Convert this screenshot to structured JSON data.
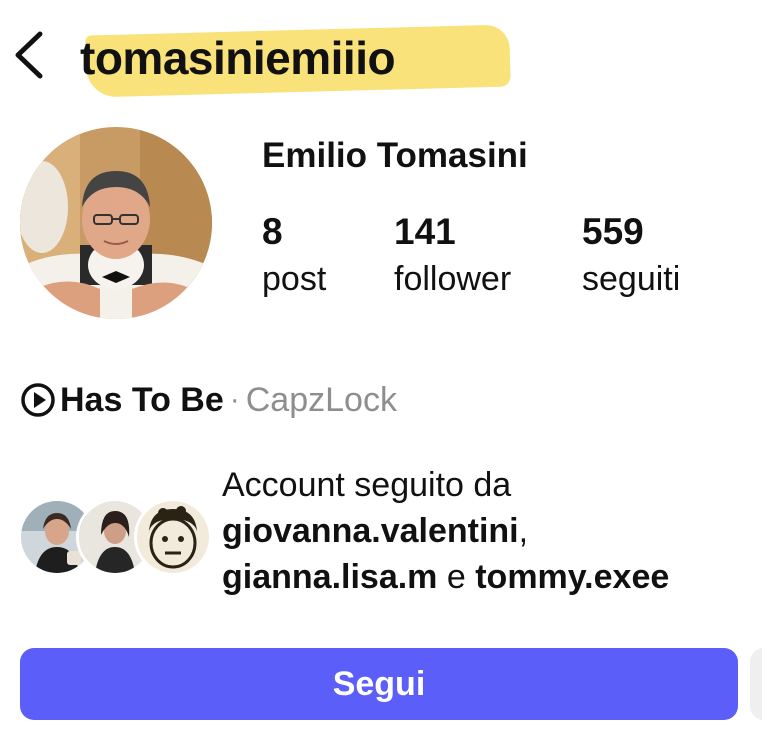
{
  "header": {
    "username": "tomasiniemiiio",
    "back_icon": "chevron-left-icon"
  },
  "profile": {
    "full_name": "Emilio Tomasini",
    "avatar_icon": "profile-photo"
  },
  "stats": {
    "posts": {
      "value": "8",
      "label": "post"
    },
    "followers": {
      "value": "141",
      "label": "follower"
    },
    "following": {
      "value": "559",
      "label": "seguiti"
    }
  },
  "music": {
    "icon": "play-circle-icon",
    "song": "Has To Be",
    "separator": "·",
    "artist": "CapzLock"
  },
  "mutual": {
    "intro": "Account seguito da",
    "user1": "giovanna.valentini",
    "comma": ",",
    "user2": "gianna.lisa.m",
    "conj": "e",
    "user3": "tommy.exee"
  },
  "actions": {
    "follow_label": "Segui"
  },
  "colors": {
    "accent": "#5b5ef8",
    "highlight": "#f7df6a",
    "muted_text": "#8e8e8e"
  }
}
